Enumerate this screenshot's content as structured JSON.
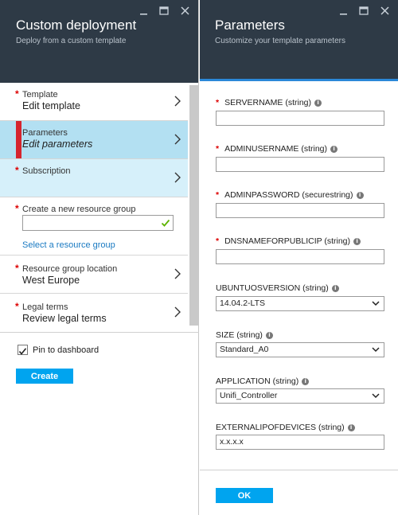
{
  "left": {
    "title": "Custom deployment",
    "subtitle": "Deploy from a custom template",
    "items": [
      {
        "label": "Template",
        "value": "Edit template",
        "required": "*"
      },
      {
        "label": "Parameters",
        "value": "Edit parameters"
      },
      {
        "label": "Subscription",
        "value": "",
        "required": "*"
      },
      {
        "label": "Create a new resource group",
        "value": "",
        "required": "*"
      },
      {
        "label": "Resource group location",
        "value": "West Europe",
        "required": "*"
      },
      {
        "label": "Legal terms",
        "value": "Review legal terms",
        "required": "*"
      }
    ],
    "select_rg_link": "Select a resource group",
    "pin_label": "Pin to dashboard",
    "pin_checked": true,
    "create_label": "Create"
  },
  "right": {
    "title": "Parameters",
    "subtitle": "Customize your template parameters",
    "fields": [
      {
        "label": "SERVERNAME (string)",
        "required": "*",
        "value": ""
      },
      {
        "label": "ADMINUSERNAME (string)",
        "required": "*",
        "value": ""
      },
      {
        "label": "ADMINPASSWORD (securestring)",
        "required": "*",
        "value": ""
      },
      {
        "label": "DNSNAMEFORPUBLICIP (string)",
        "required": "*",
        "value": ""
      },
      {
        "label": "UBUNTUOSVERSION (string)",
        "value": "14.04.2-LTS"
      },
      {
        "label": "SIZE (string)",
        "value": "Standard_A0"
      },
      {
        "label": "APPLICATION (string)",
        "value": "Unifi_Controller"
      },
      {
        "label": "EXTERNALIPOFDEVICES (string)",
        "value": "x.x.x.x"
      }
    ],
    "ok_label": "OK"
  },
  "info_glyph": "i",
  "colors": {
    "header_bg": "#2e3a46",
    "accent": "#00a4ef",
    "selected_bg": "#b3e0f2",
    "marker": "#d6242d",
    "link": "#1a7ac2",
    "required": "#d00000"
  },
  "icons": {
    "minimize": "minimize-icon",
    "maximize": "maximize-icon",
    "close": "close-icon",
    "chevron": "chevron-right-icon",
    "check": "check-icon",
    "caret": "chevron-down-icon",
    "info": "info-icon"
  }
}
